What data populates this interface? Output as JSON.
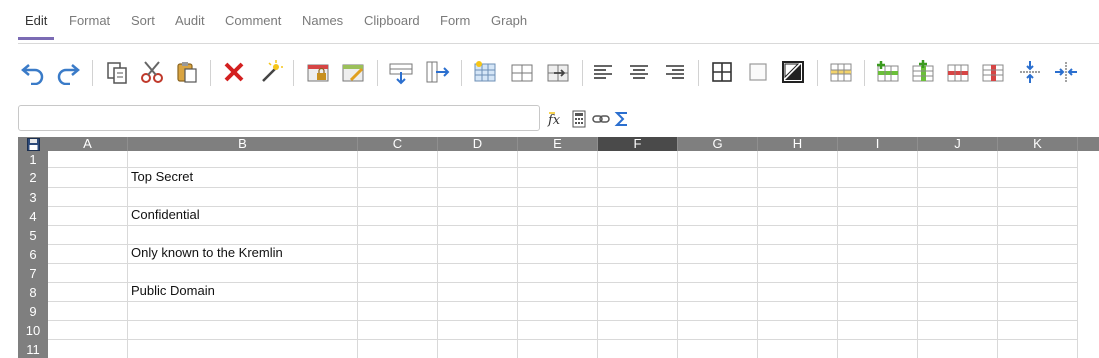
{
  "tabs": [
    "Edit",
    "Format",
    "Sort",
    "Audit",
    "Comment",
    "Names",
    "Clipboard",
    "Form",
    "Graph"
  ],
  "active_tab": "Edit",
  "toolbar": {
    "icons": [
      "undo-icon",
      "redo-icon",
      "copy-icon",
      "cut-icon",
      "paste-icon",
      "delete-icon",
      "clear-wand-icon",
      "lock-cells-icon",
      "edit-cells-icon",
      "insert-row-icon",
      "insert-column-icon",
      "select-table-icon",
      "table-icon",
      "move-cells-icon",
      "align-left-icon",
      "align-center-icon",
      "align-right-icon",
      "borders-icon",
      "no-fill-icon",
      "color-icon",
      "header-row-icon",
      "add-row-icon",
      "add-column-icon",
      "delete-row-icon",
      "delete-column-icon",
      "merge-vertical-icon",
      "merge-horizontal-icon"
    ],
    "accent": "#7b6bb4"
  },
  "formula_bar": {
    "value": "",
    "icons": [
      "function-icon",
      "calculator-icon",
      "link-icon",
      "sum-icon"
    ]
  },
  "grid": {
    "columns": [
      "A",
      "B",
      "C",
      "D",
      "E",
      "F",
      "G",
      "H",
      "I",
      "J",
      "K"
    ],
    "selected_column": "F",
    "rows": [
      {
        "num": "1",
        "cells": [
          "",
          "",
          "",
          "",
          "",
          "",
          "",
          "",
          "",
          "",
          ""
        ]
      },
      {
        "num": "2",
        "cells": [
          "",
          "Top Secret",
          "",
          "",
          "",
          "",
          "",
          "",
          "",
          "",
          ""
        ]
      },
      {
        "num": "3",
        "cells": [
          "",
          "",
          "",
          "",
          "",
          "",
          "",
          "",
          "",
          "",
          ""
        ]
      },
      {
        "num": "4",
        "cells": [
          "",
          "Confidential",
          "",
          "",
          "",
          "",
          "",
          "",
          "",
          "",
          ""
        ]
      },
      {
        "num": "5",
        "cells": [
          "",
          "",
          "",
          "",
          "",
          "",
          "",
          "",
          "",
          "",
          ""
        ]
      },
      {
        "num": "6",
        "cells": [
          "",
          "Only known to the Kremlin",
          "",
          "",
          "",
          "",
          "",
          "",
          "",
          "",
          ""
        ]
      },
      {
        "num": "7",
        "cells": [
          "",
          "",
          "",
          "",
          "",
          "",
          "",
          "",
          "",
          "",
          ""
        ]
      },
      {
        "num": "8",
        "cells": [
          "",
          "Public Domain",
          "",
          "",
          "",
          "",
          "",
          "",
          "",
          "",
          ""
        ]
      },
      {
        "num": "9",
        "cells": [
          "",
          "",
          "",
          "",
          "",
          "",
          "",
          "",
          "",
          "",
          ""
        ]
      },
      {
        "num": "10",
        "cells": [
          "",
          "",
          "",
          "",
          "",
          "",
          "",
          "",
          "",
          "",
          ""
        ]
      },
      {
        "num": "11",
        "cells": [
          "",
          "",
          "",
          "",
          "",
          "",
          "",
          "",
          "",
          "",
          ""
        ]
      }
    ]
  }
}
